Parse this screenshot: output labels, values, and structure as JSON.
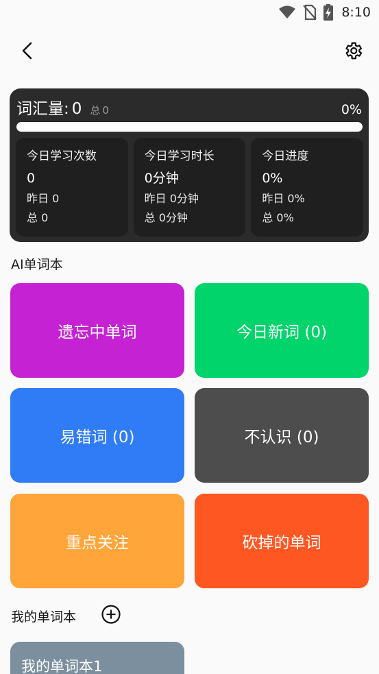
{
  "status_bar": {
    "time": "8:10"
  },
  "stats": {
    "vocab_label": "词汇量:",
    "vocab_value": "0",
    "vocab_total_label": "总",
    "vocab_total_value": "0",
    "percent": "0%",
    "progress_fraction": 0,
    "tiles": [
      {
        "title": "今日学习次数",
        "value": "0",
        "yesterday": "昨日 0",
        "total": "总 0"
      },
      {
        "title": "今日学习时长",
        "value": "0分钟",
        "yesterday": "昨日 0分钟",
        "total": "总 0分钟"
      },
      {
        "title": "今日进度",
        "value": "0%",
        "yesterday": "昨日 0%",
        "total": "总 0%"
      }
    ]
  },
  "ai_section": {
    "title": "AI单词本",
    "books": [
      {
        "label": "遗忘中单词",
        "color": "#c522d3"
      },
      {
        "label": "今日新词 (0)",
        "color": "#00d46a"
      },
      {
        "label": "易错词 (0)",
        "color": "#2f7cf6"
      },
      {
        "label": "不认识 (0)",
        "color": "#4d4d4d"
      },
      {
        "label": "重点关注",
        "color": "#ffa53a"
      },
      {
        "label": "砍掉的单词",
        "color": "#ff5722"
      }
    ]
  },
  "my_section": {
    "title": "我的单词本",
    "books": [
      {
        "label": "我的单词本1",
        "color": "#7b8f9e"
      }
    ]
  },
  "icons": {
    "back": "back-arrow-icon",
    "settings": "gear-icon",
    "add": "add-circle-icon",
    "wifi": "wifi-icon",
    "no_sim": "no-sim-icon",
    "battery": "battery-charging-icon"
  }
}
